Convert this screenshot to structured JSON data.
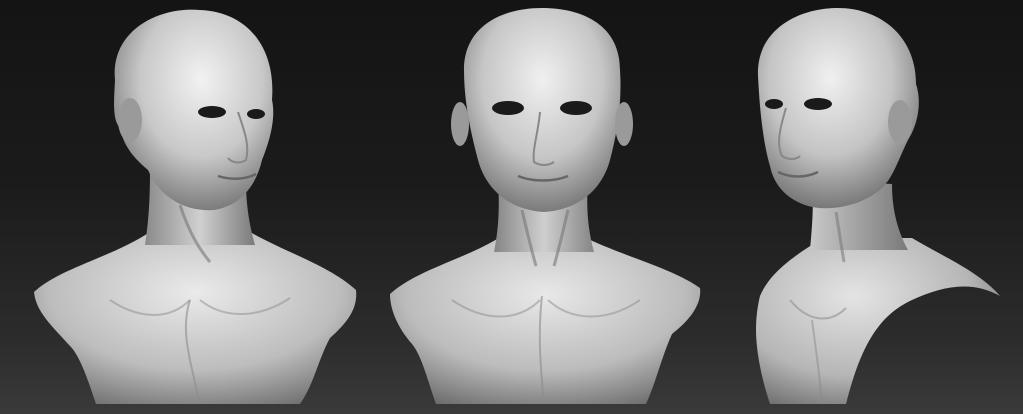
{
  "scene": {
    "description_hidden": "",
    "background_top": "#141414",
    "background_bottom": "#3a3a3a",
    "sculpt_color": "#cfcfcf",
    "shadow_color": "#5a5a5a",
    "views": [
      {
        "view": "three-quarter-left"
      },
      {
        "view": "front"
      },
      {
        "view": "three-quarter-right"
      }
    ]
  }
}
